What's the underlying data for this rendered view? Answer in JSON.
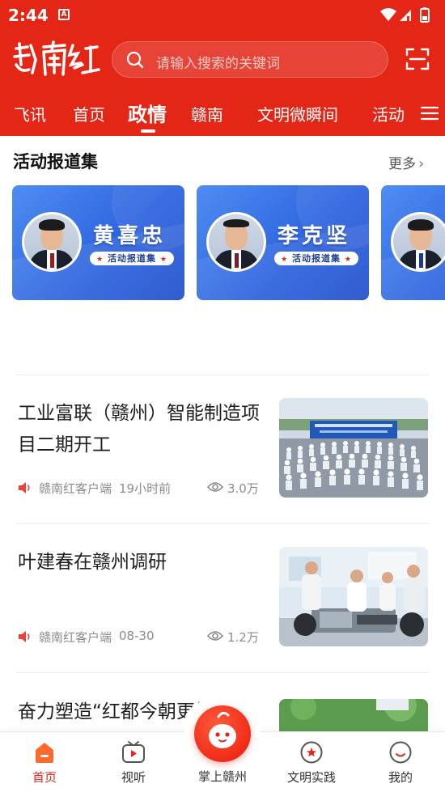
{
  "status_bar": {
    "time": "2:44",
    "notification_letter": "A"
  },
  "header": {
    "logo_text": "赣南红",
    "search_placeholder": "请输入搜索的关键词"
  },
  "nav_tabs": [
    {
      "label": "飞讯",
      "active": false
    },
    {
      "label": "首页",
      "active": false
    },
    {
      "label": "政情",
      "active": true
    },
    {
      "label": "赣南",
      "active": false
    },
    {
      "label": "文明微瞬间",
      "active": false
    },
    {
      "label": "活动",
      "active": false
    }
  ],
  "activity_section": {
    "title": "活动报道集",
    "more_label": "更多",
    "cards": [
      {
        "name": "黄喜忠",
        "badge": "活动报道集"
      },
      {
        "name": "李克坚",
        "badge": "活动报道集"
      },
      {
        "name": "",
        "badge": ""
      }
    ]
  },
  "news": [
    {
      "title": "工业富联（赣州）智能制造项目二期开工",
      "source": "赣南红客户端",
      "time": "19小时前",
      "views": "3.0万"
    },
    {
      "title": "叶建春在赣州调研",
      "source": "赣南红客户端",
      "time": "08-30",
      "views": "1.2万"
    },
    {
      "title": "奋力塑造“红都今朝更好",
      "source": "",
      "time": "",
      "views": ""
    }
  ],
  "bottom_nav": [
    {
      "label": "首页",
      "active": true
    },
    {
      "label": "视听",
      "active": false
    },
    {
      "label": "掌上赣州",
      "active": false
    },
    {
      "label": "文明实践",
      "active": false
    },
    {
      "label": "我的",
      "active": false
    }
  ],
  "colors": {
    "brand_red": "#e42617",
    "card_blue": "#2c62de"
  }
}
